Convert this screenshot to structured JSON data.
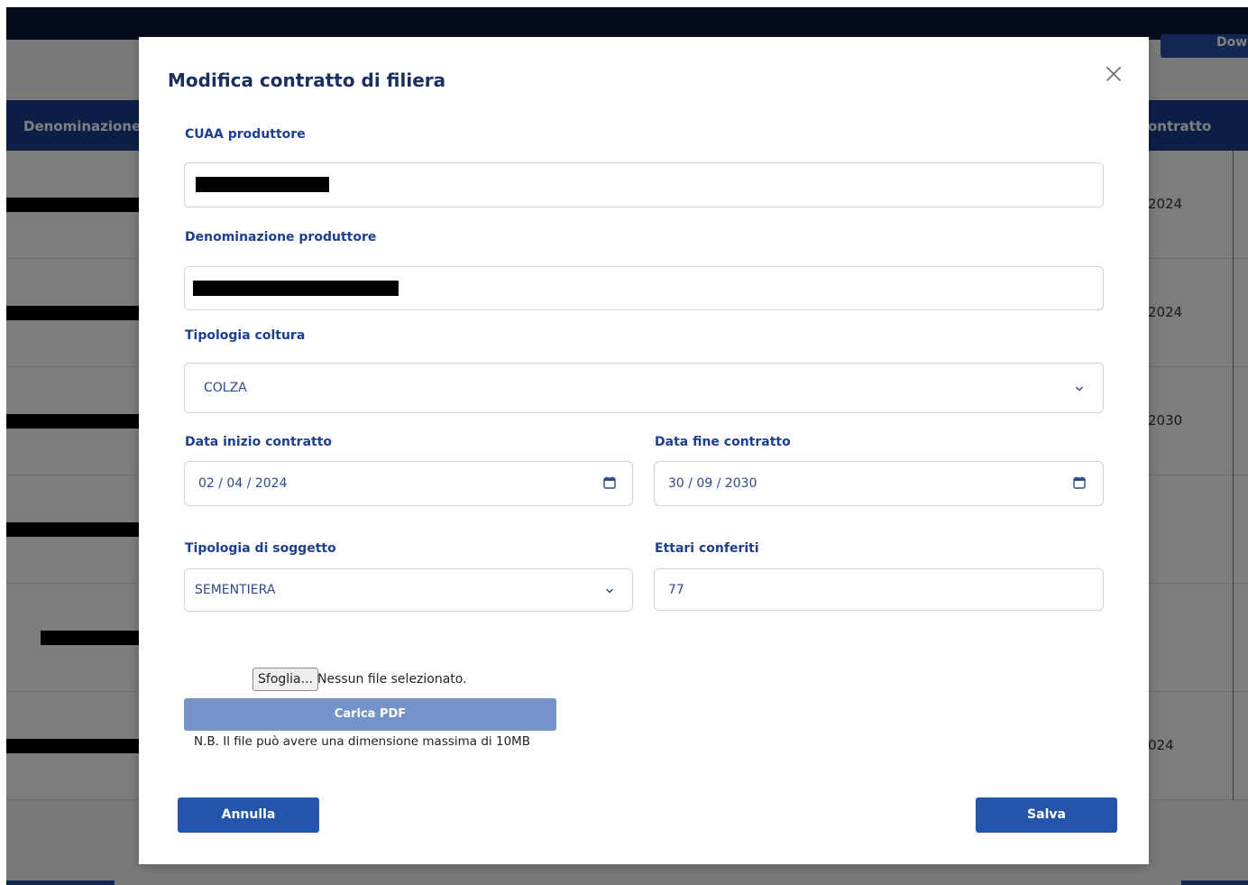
{
  "background": {
    "download_label": "Dow",
    "table_header_left": "Denominazione p",
    "table_header_right": "ontratto",
    "rows": [
      {
        "right_text": "2024"
      },
      {
        "right_text": "2024"
      },
      {
        "right_text": "2030"
      },
      {
        "right_text": ""
      },
      {
        "right_text": ""
      },
      {
        "right_text": "024"
      }
    ]
  },
  "modal": {
    "title": "Modifica contratto di filiera",
    "cuaa": {
      "label": "CUAA produttore",
      "value": ""
    },
    "denominazione": {
      "label": "Denominazione produttore",
      "value": ""
    },
    "tipologia_coltura": {
      "label": "Tipologia coltura",
      "selected": "COLZA"
    },
    "data_inizio": {
      "label": "Data inizio contratto",
      "value": "02 / 04 / 2024"
    },
    "data_fine": {
      "label": "Data fine contratto",
      "value": "30 / 09 / 2030"
    },
    "tipologia_soggetto": {
      "label": "Tipologia di soggetto",
      "selected": "SEMENTIERA"
    },
    "ettari": {
      "label": "Ettari conferiti",
      "value": "77"
    },
    "file": {
      "browse_label": "Sfoglia...",
      "status": "Nessun file selezionato.",
      "upload_label": "Carica PDF",
      "note": "N.B. Il file può avere una dimensione massima di 10MB"
    },
    "cancel_label": "Annulla",
    "save_label": "Salva"
  },
  "colors": {
    "primary": "#2455ab",
    "label": "#1e3f8e",
    "title": "#1b2f5c",
    "upload_disabled": "#7393c9",
    "topbar": "#0b1a3a"
  },
  "icons": {
    "close": "close-icon",
    "select": "chevron-down-icon",
    "date": "calendar-icon"
  }
}
